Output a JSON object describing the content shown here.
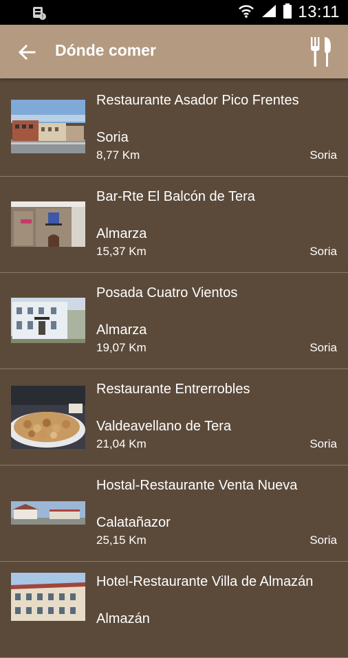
{
  "status_bar": {
    "time": "13:11",
    "icons": [
      "sim-card-icon",
      "wifi-icon",
      "signal-icon",
      "battery-icon"
    ]
  },
  "app_bar": {
    "title": "Dónde comer",
    "back_icon": "arrow-back-icon",
    "action_icon": "fork-knife-icon"
  },
  "colors": {
    "background": "#5b4a3a",
    "app_bar": "#b49a80",
    "divider": "#8f7b66"
  },
  "restaurants": [
    {
      "name": "Restaurante Asador Pico Frentes",
      "town": "Soria",
      "distance": "8,77 Km",
      "province": "Soria"
    },
    {
      "name": "Bar-Rte El Balcón de Tera",
      "town": "Almarza",
      "distance": "15,37 Km",
      "province": "Soria"
    },
    {
      "name": "Posada Cuatro Vientos",
      "town": "Almarza",
      "distance": "19,07 Km",
      "province": "Soria"
    },
    {
      "name": "Restaurante Entrerrobles",
      "town": "Valdeavellano de Tera",
      "distance": "21,04 Km",
      "province": "Soria"
    },
    {
      "name": "Hostal-Restaurante Venta Nueva",
      "town": "Calatañazor",
      "distance": "25,15 Km",
      "province": "Soria"
    },
    {
      "name": "Hotel-Restaurante Villa de Almazán",
      "town": "Almazán",
      "distance": "",
      "province": ""
    }
  ]
}
